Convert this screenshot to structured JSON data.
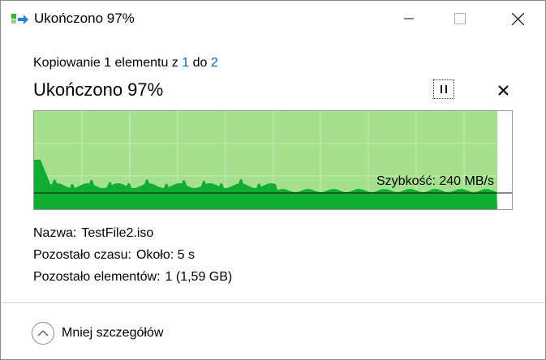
{
  "window": {
    "title": "Ukończono 97%",
    "controls": {
      "minimize": "minimize",
      "maximize": "maximize",
      "close": "close"
    }
  },
  "copy_status": {
    "prefix": "Kopiowanie 1 elementu z",
    "source": "1",
    "connector": "do",
    "destination": "2"
  },
  "progress": {
    "title": "Ukończono 97%",
    "percent": 97
  },
  "graph": {
    "speed_label": "Szybkość: 240 MB/s",
    "fill_color": "#a5e08f",
    "wave_color": "#0fae32",
    "grid_color": "#c6ebb8"
  },
  "details": {
    "name_label": "Nazwa:",
    "name_value": "TestFile2.iso",
    "time_label": "Pozostało czasu:",
    "time_value": "Około: 5 s",
    "items_label": "Pozostało elementów:",
    "items_value": "1 (1,59 GB)"
  },
  "footer": {
    "toggle_label": "Mniej szczegółów"
  }
}
